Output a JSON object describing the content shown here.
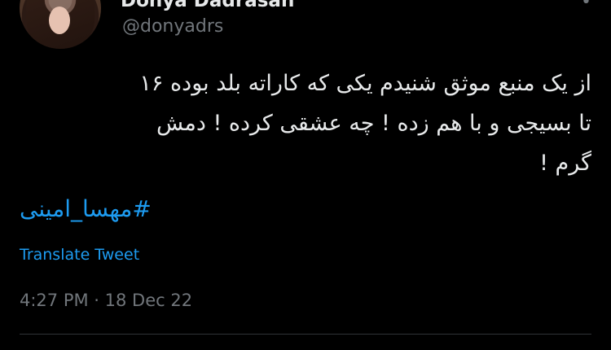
{
  "user": {
    "display_name": "Donya Dadrasan",
    "handle": "@donyadrs"
  },
  "tweet": {
    "text": "از یک منبع موثق شنیدم یکی که کاراته بلد بوده ۱۶\nتا بسیجی و با هم زده ! چه عشقی کرده ! دمش\nگرم !",
    "hashtag": "#مهسا_امینی",
    "translate_label": "Translate Tweet",
    "timestamp": "4:27 PM · 18 Dec 22"
  },
  "icons": {
    "more": "more-horizontal-icon"
  },
  "colors": {
    "background": "#000000",
    "text": "#e7e9ea",
    "secondary": "#71767b",
    "link": "#1d9bf0"
  }
}
